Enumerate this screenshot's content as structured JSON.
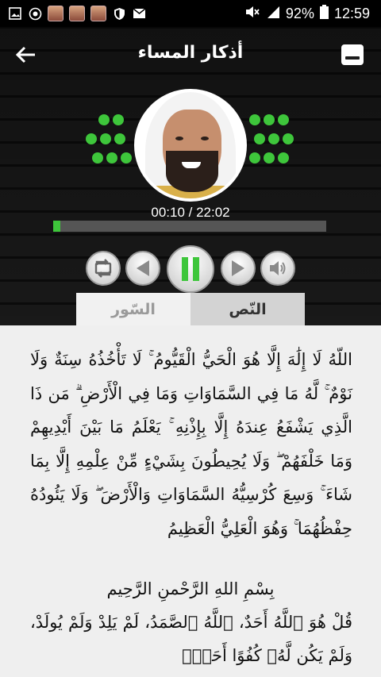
{
  "status_bar": {
    "battery": "92%",
    "clock": "12:59",
    "left_icons": [
      "image-icon",
      "media-icon",
      "avatar",
      "avatar",
      "avatar",
      "shield-icon",
      "mail-icon"
    ],
    "right_icons": [
      "mute-icon",
      "signal-icon",
      "battery-icon"
    ]
  },
  "header": {
    "title": "أذكار المساء",
    "back_icon": "arrow-left-icon",
    "menu_icon": "minus-square-icon"
  },
  "player": {
    "time_display": "00:10 / 22:02",
    "progress_fraction": 0.0076,
    "accent_color": "#3ec63b",
    "controls": [
      "repeat-icon",
      "previous-icon",
      "pause-icon",
      "next-icon",
      "volume-icon"
    ]
  },
  "tabs": [
    {
      "label": "السّور",
      "active": false
    },
    {
      "label": "النّص",
      "active": true
    }
  ],
  "content": {
    "ayat_al_kursi": "اللّهُ لَا إِلَٰهَ إِلَّا هُوَ الْحَيُّ الْقَيُّومُ ۚ لَا تَأْخُذُهُ سِنَةٌ وَلَا نَوْمٌ ۚ لَّهُ مَا فِي السَّمَاوَاتِ وَمَا فِي الْأَرْضِ ۗ مَن ذَا الَّذِي يَشْفَعُ عِندَهُ إِلَّا بِإِذْنِهِ ۚ يَعْلَمُ مَا بَيْنَ أَيْدِيهِمْ وَمَا خَلْفَهُمْ ۖ وَلَا يُحِيطُونَ بِشَيْءٍ مِّنْ عِلْمِهِ إِلَّا بِمَا شَاءَ ۚ وَسِعَ كُرْسِيُّهُ السَّمَاوَاتِ وَالْأَرْضَ ۖ وَلَا يَئُودُهُ حِفْظُهُمَا ۚ وَهُوَ الْعَلِيُّ الْعَظِيمُ",
    "basmala": "بِسْمِ اللهِ الرَّحْمنِ الرَّحِيم",
    "ikhlas": "قُلْ هُوَ ٱللَّهُ أَحَدٌ، ٱللَّهُ ٱلصَّمَدُ، لَمْ يَلِدْ وَلَمْ يُولَدْ، وَلَمْ يَكُن لَّهُۥ كُفُوًا أَحَدٌۢ"
  }
}
